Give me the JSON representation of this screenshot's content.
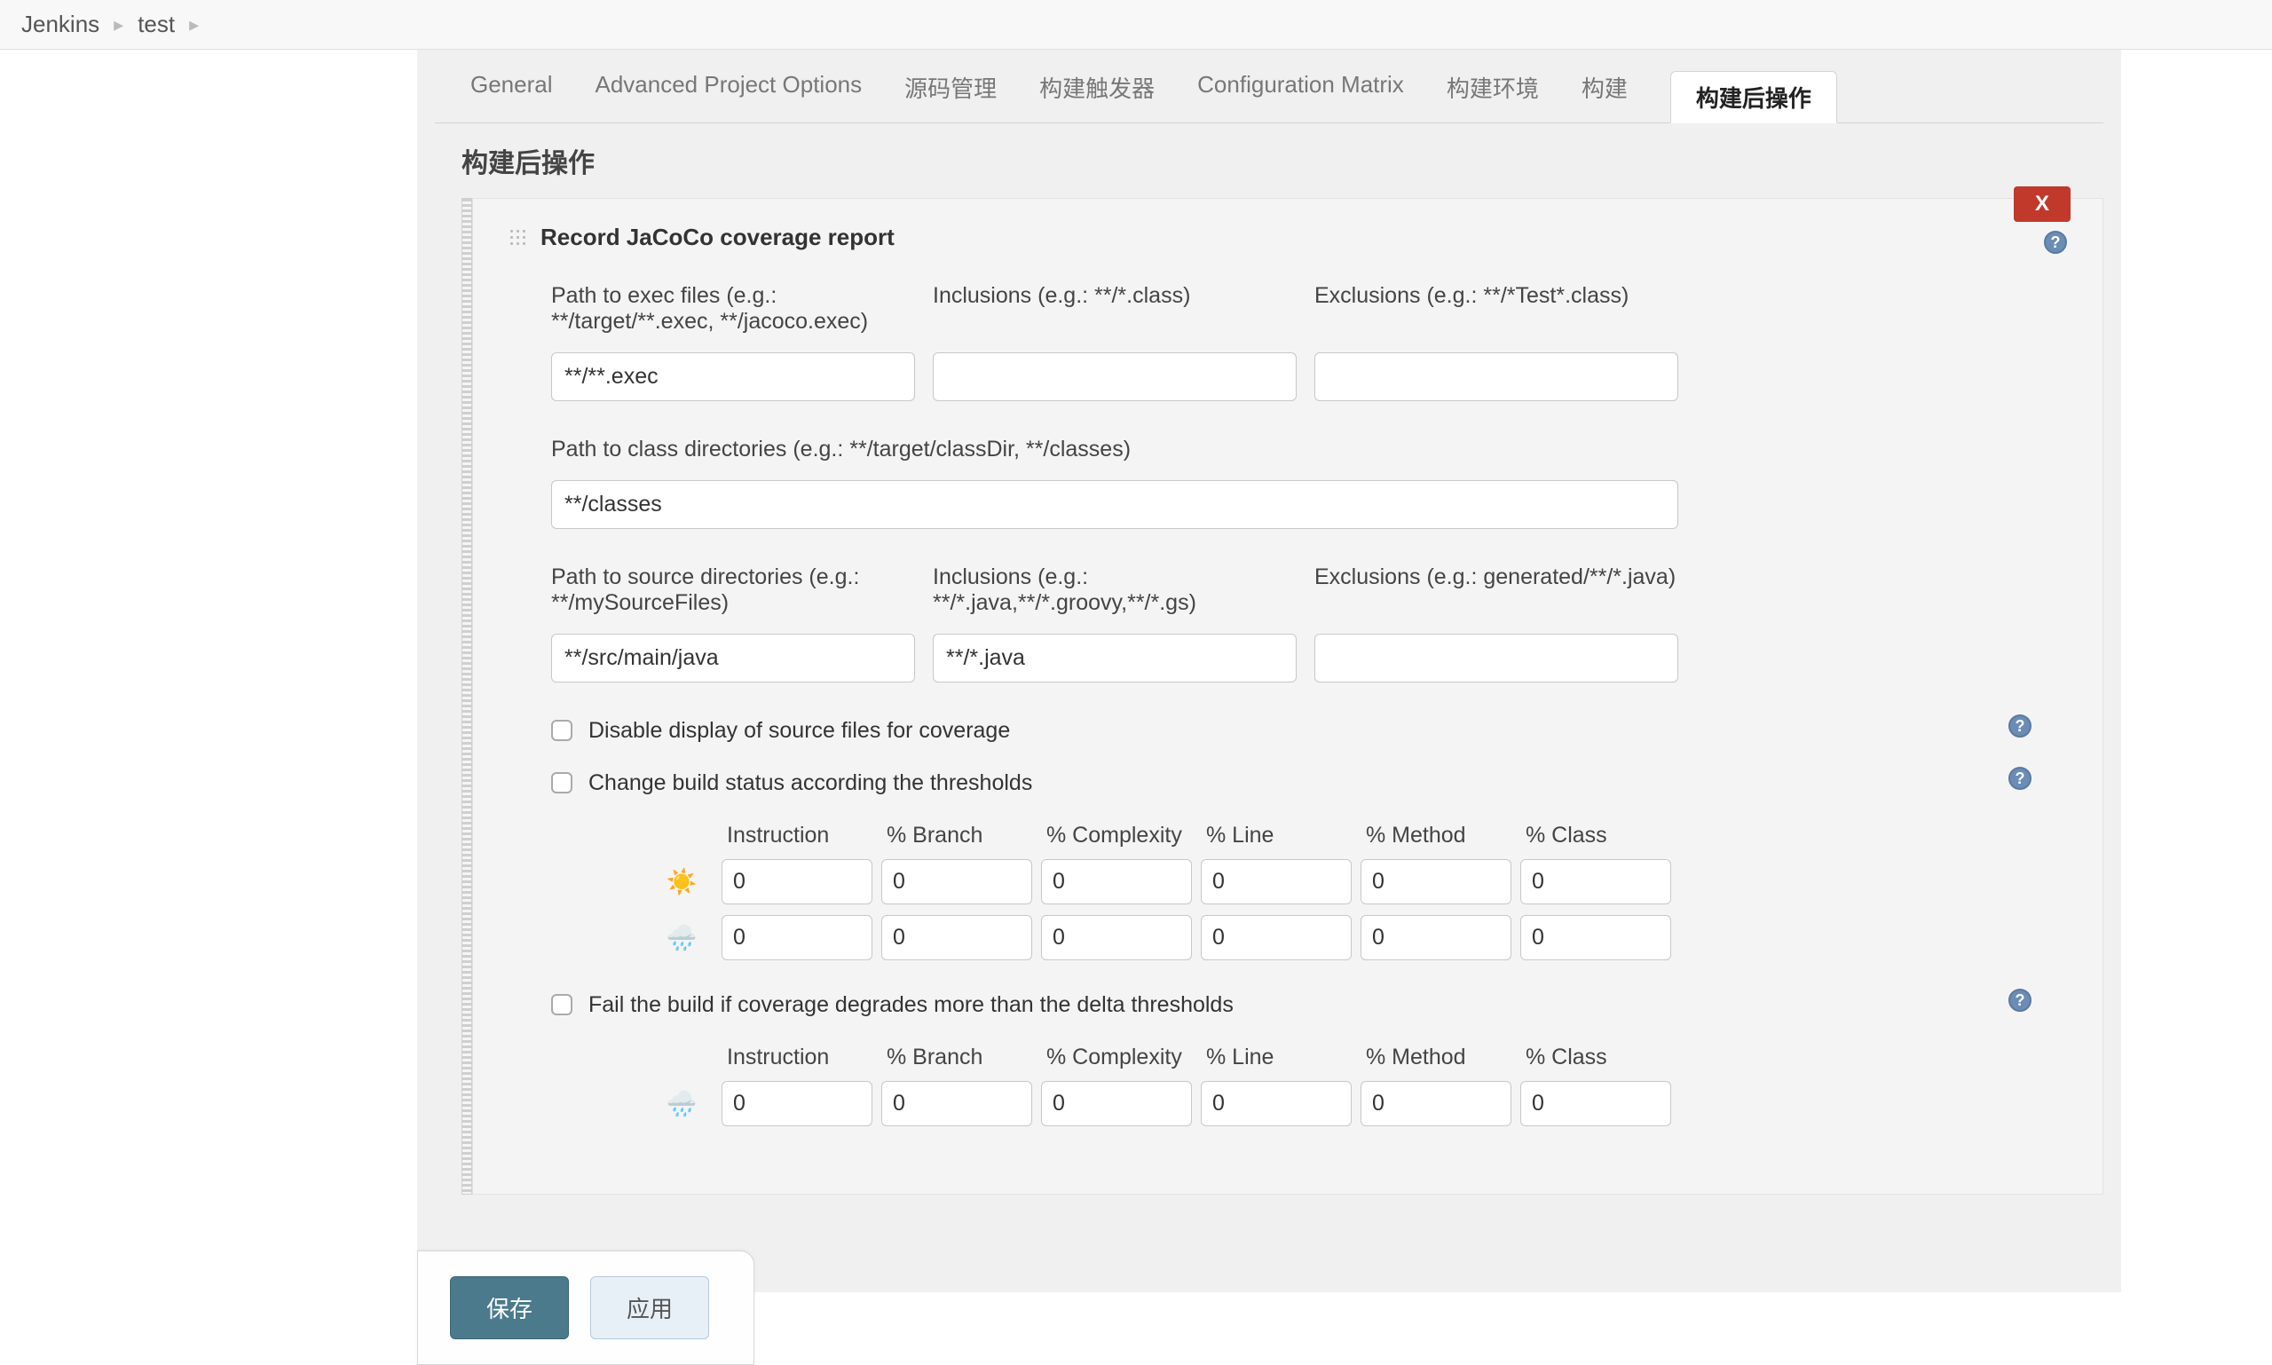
{
  "breadcrumb": {
    "items": [
      "Jenkins",
      "test"
    ]
  },
  "tabs": {
    "items": [
      "General",
      "Advanced Project Options",
      "源码管理",
      "构建触发器",
      "Configuration Matrix",
      "构建环境",
      "构建",
      "构建后操作"
    ],
    "activeIndex": 7
  },
  "section": {
    "title": "构建后操作"
  },
  "card": {
    "title": "Record JaCoCo coverage report",
    "delete_label": "X",
    "exec": {
      "path_label": "Path to exec files (e.g.: **/target/**.exec, **/jacoco.exec)",
      "path_value": "**/**.exec",
      "inclusions_label": "Inclusions (e.g.: **/*.class)",
      "inclusions_value": "",
      "exclusions_label": "Exclusions (e.g.: **/*Test*.class)",
      "exclusions_value": ""
    },
    "classdir": {
      "label": "Path to class directories (e.g.: **/target/classDir, **/classes)",
      "value": "**/classes"
    },
    "source": {
      "path_label": "Path to source directories (e.g.: **/mySourceFiles)",
      "path_value": "**/src/main/java",
      "inclusions_label": "Inclusions (e.g.: **/*.java,**/*.groovy,**/*.gs)",
      "inclusions_value": "**/*.java",
      "exclusions_label": "Exclusions (e.g.: generated/**/*.java)",
      "exclusions_value": ""
    },
    "checks": {
      "disable_source": "Disable display of source files for coverage",
      "change_status": "Change build status according the thresholds",
      "fail_build": "Fail the build if coverage degrades more than the delta thresholds"
    },
    "thresholds": {
      "headers": [
        "Instruction",
        "% Branch",
        "% Complexity",
        "% Line",
        "% Method",
        "% Class"
      ],
      "sun_row": [
        "0",
        "0",
        "0",
        "0",
        "0",
        "0"
      ],
      "cloud_row": [
        "0",
        "0",
        "0",
        "0",
        "0",
        "0"
      ],
      "delta_row": [
        "0",
        "0",
        "0",
        "0",
        "0",
        "0"
      ],
      "icon_sun": "☀️",
      "icon_cloud": "🌧️"
    }
  },
  "footer": {
    "save": "保存",
    "apply": "应用"
  },
  "help_glyph": "?"
}
